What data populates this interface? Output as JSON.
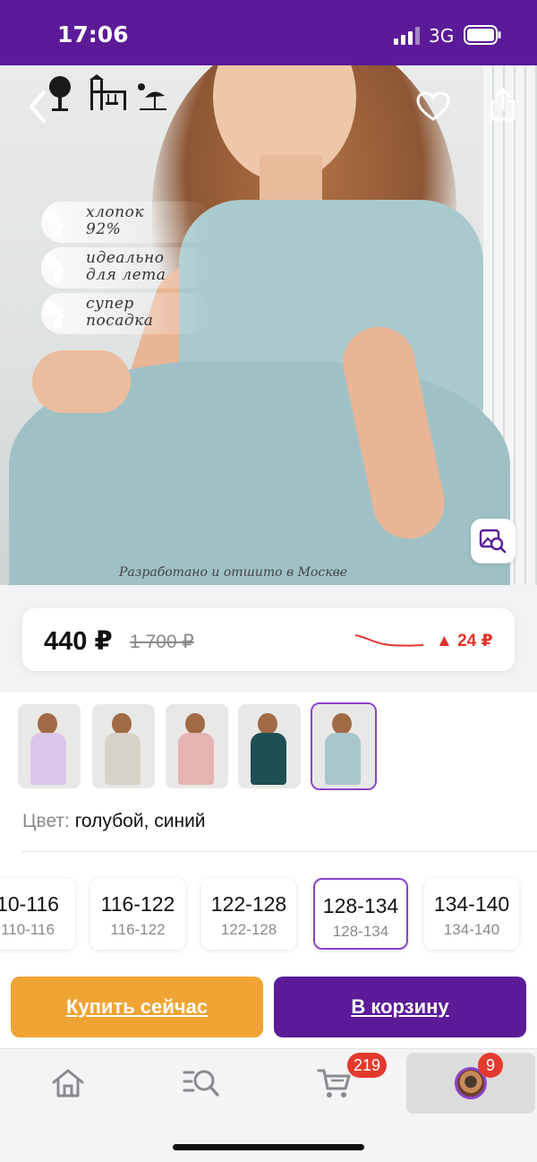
{
  "status_bar": {
    "time": "17:06",
    "network": "3G"
  },
  "hero": {
    "features": [
      {
        "line1": "хлопок",
        "line2": "92%"
      },
      {
        "line1": "идеально",
        "line2": "для лета"
      },
      {
        "line1": "супер",
        "line2": "посадка"
      }
    ],
    "caption": "Разработано и отшито в Москве"
  },
  "price_card": {
    "price": "440 ₽",
    "old_price": "1 700 ₽",
    "change": "▲ 24 ₽",
    "change_color": "#e0342b"
  },
  "thumbnails": [
    {
      "name": "lilac",
      "dress_color": "#d9c6ea",
      "selected": false
    },
    {
      "name": "floral",
      "dress_color": "#d6d2c8",
      "selected": false
    },
    {
      "name": "pink",
      "dress_color": "#e6b2b2",
      "selected": false
    },
    {
      "name": "dark-teal",
      "dress_color": "#1f4f55",
      "selected": false
    },
    {
      "name": "blue",
      "dress_color": "#a6c6cb",
      "selected": true
    }
  ],
  "color": {
    "label": "Цвет:",
    "value": "голубой, синий"
  },
  "sizes": [
    {
      "main": "10-116",
      "sub": "110-116",
      "selected": false
    },
    {
      "main": "116-122",
      "sub": "116-122",
      "selected": false
    },
    {
      "main": "122-128",
      "sub": "122-128",
      "selected": false
    },
    {
      "main": "128-134",
      "sub": "128-134",
      "selected": true
    },
    {
      "main": "134-140",
      "sub": "134-140",
      "selected": false
    }
  ],
  "actions": {
    "buy_now": "Купить сейчас",
    "add_to_cart": "В корзину"
  },
  "tabbar": {
    "items": [
      {
        "icon": "home-icon"
      },
      {
        "icon": "catalog-search-icon"
      },
      {
        "icon": "cart-icon",
        "badge": "219"
      },
      {
        "icon": "profile-avatar",
        "badge": "9",
        "active": true
      }
    ]
  },
  "colors": {
    "brand": "#5b1b98",
    "accent_orange": "#f0a433",
    "selected_outline": "#8c44c9",
    "badge": "#e43a2e"
  }
}
